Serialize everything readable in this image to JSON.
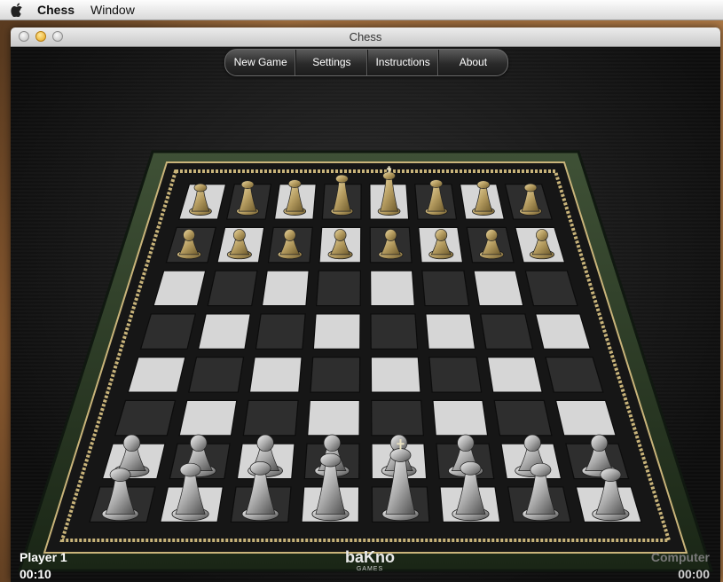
{
  "menubar": {
    "app_name": "Chess",
    "menu_window": "Window"
  },
  "window": {
    "title": "Chess"
  },
  "toolbar": {
    "new_game": "New Game",
    "settings": "Settings",
    "instructions": "Instructions",
    "about": "About"
  },
  "board": {
    "light_square": "#d6d6d6",
    "dark_square": "#2e2e2e",
    "frame_color": "#24341f",
    "trim_color": "#c9b47a",
    "black_pieces_color": "#b39a5e",
    "white_pieces_color": "#c2c2c2",
    "gold_rank8": [
      "rook",
      "knight",
      "bishop",
      "queen",
      "king",
      "bishop",
      "knight",
      "rook"
    ],
    "gold_rank7": [
      "pawn",
      "pawn",
      "pawn",
      "pawn",
      "pawn",
      "pawn",
      "pawn",
      "pawn"
    ],
    "silver_rank2": [
      "pawn",
      "pawn",
      "pawn",
      "pawn",
      "pawn",
      "pawn",
      "pawn",
      "pawn"
    ],
    "silver_rank1": [
      "rook",
      "knight",
      "bishop",
      "queen",
      "king",
      "bishop",
      "knight",
      "rook"
    ]
  },
  "branding": {
    "logo_word": "baKno",
    "logo_sub": "GAMES"
  },
  "players": {
    "left_name": "Player 1",
    "left_time": "00:10",
    "right_name": "Computer",
    "right_time": "00:00"
  }
}
